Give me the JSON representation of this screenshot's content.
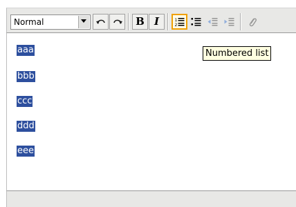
{
  "toolbar": {
    "format_select": {
      "value": "Normal"
    },
    "buttons": {
      "undo": "undo-icon",
      "redo": "redo-icon",
      "bold": "B",
      "italic": "I",
      "numbered_list": "numbered-list-icon",
      "bulleted_list": "bulleted-list-icon",
      "outdent": "outdent-icon",
      "indent": "indent-icon",
      "attach": "paperclip-icon"
    },
    "active_button": "numbered_list",
    "colors": {
      "active_border": "#f0a000",
      "toolbar_bg": "#e8e8e6"
    }
  },
  "content": {
    "lines": [
      "aaa",
      "bbb",
      "ccc",
      "ddd",
      "eee"
    ],
    "selection_color": "#2d4f9e"
  },
  "tooltip": {
    "text": "Numbered list"
  }
}
